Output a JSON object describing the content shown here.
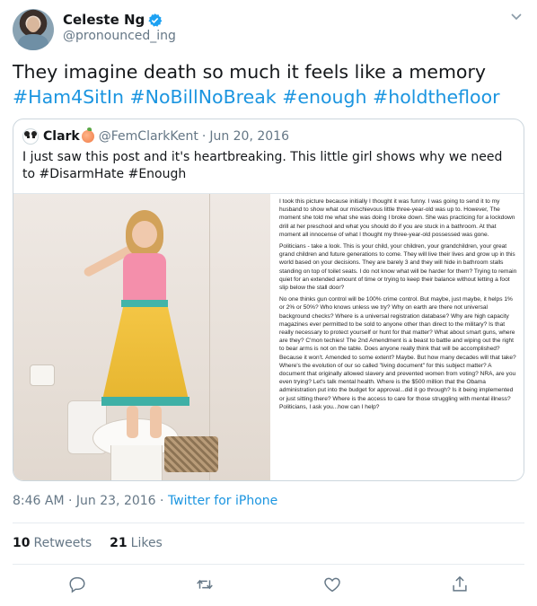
{
  "author": {
    "display_name": "Celeste Ng",
    "handle": "@pronounced_ing"
  },
  "tweet": {
    "text_plain": "They imagine death so much it feels like a memory ",
    "hashtags": [
      "#Ham4SitIn",
      "#NoBillNoBreak",
      "#enough",
      "#holdthefloor"
    ]
  },
  "quoted": {
    "display_name": "Clark",
    "handle": "@FemClarkKent",
    "separator": "·",
    "date": "Jun 20, 2016",
    "text": "I just saw this post and it's heartbreaking. This little girl shows why we need to #DisarmHate #Enough",
    "article_paragraphs": [
      "I took this picture because initially I thought it was funny. I was going to send it to my husband to show what our mischievous little three-year-old was up to. However, The moment she told me what she was doing I broke down. She was practicing for a lockdown drill at her preschool and what you should do if you are stuck in a bathroom. At that moment all innocense of what I thought my three-year-old possessed was gone.",
      "Politicians - take a look. This is your child, your children, your grandchildren, your great grand children and future generations to come. They will live their lives and grow up in this world based on your decisions. They are barely 3 and they will hide in bathroom stalls standing on top of toilet seats. I do not know what will be harder for them? Trying to remain quiet for an extended amount of time or trying to keep their balance without letting a foot slip below the stall door?",
      "No one thinks gun control will be 100% crime control. But maybe, just maybe, it helps 1% or 2% or 50%? Who knows unless we try? Why on earth are there not universal background checks? Where is a universal registration database? Why are high capacity magazines ever permitted to be sold to anyone other than direct to the military? Is that really necessary to protect yourself or hunt for that matter? What about smart guns, where are they? C'mon techies! The 2nd Amendment is a beast to battle and wiping out the right to bear arms is not on the table. Does anyone really think that will be accomplished? Because it won't. Amended to some extent? Maybe. But how many decades will that take? Where's the evolution of our so called \"living document\" for this subject matter? A document that originally allowed slavery and prevented women from voting? NRA, are you even trying? Let's talk mental health. Where is the $500 million that the Obama administration put into the budget for approval...did it go through? Is it being implemented or just sitting there? Where is the access to care for those struggling with mental illness? Politicians, I ask you...how can I help?"
    ]
  },
  "meta": {
    "time": "8:46 AM",
    "separator": "·",
    "date": "Jun 23, 2016",
    "source": "Twitter for iPhone"
  },
  "stats": {
    "retweets_count": "10",
    "retweets_label": "Retweets",
    "likes_count": "21",
    "likes_label": "Likes"
  },
  "icons": [
    "verified-badge-icon",
    "chevron-down-icon",
    "reply-icon",
    "retweet-icon",
    "like-icon",
    "share-icon"
  ],
  "colors": {
    "link": "#1b95e0",
    "muted": "#657786",
    "text": "#14171a",
    "border": "#ccd6dd"
  }
}
